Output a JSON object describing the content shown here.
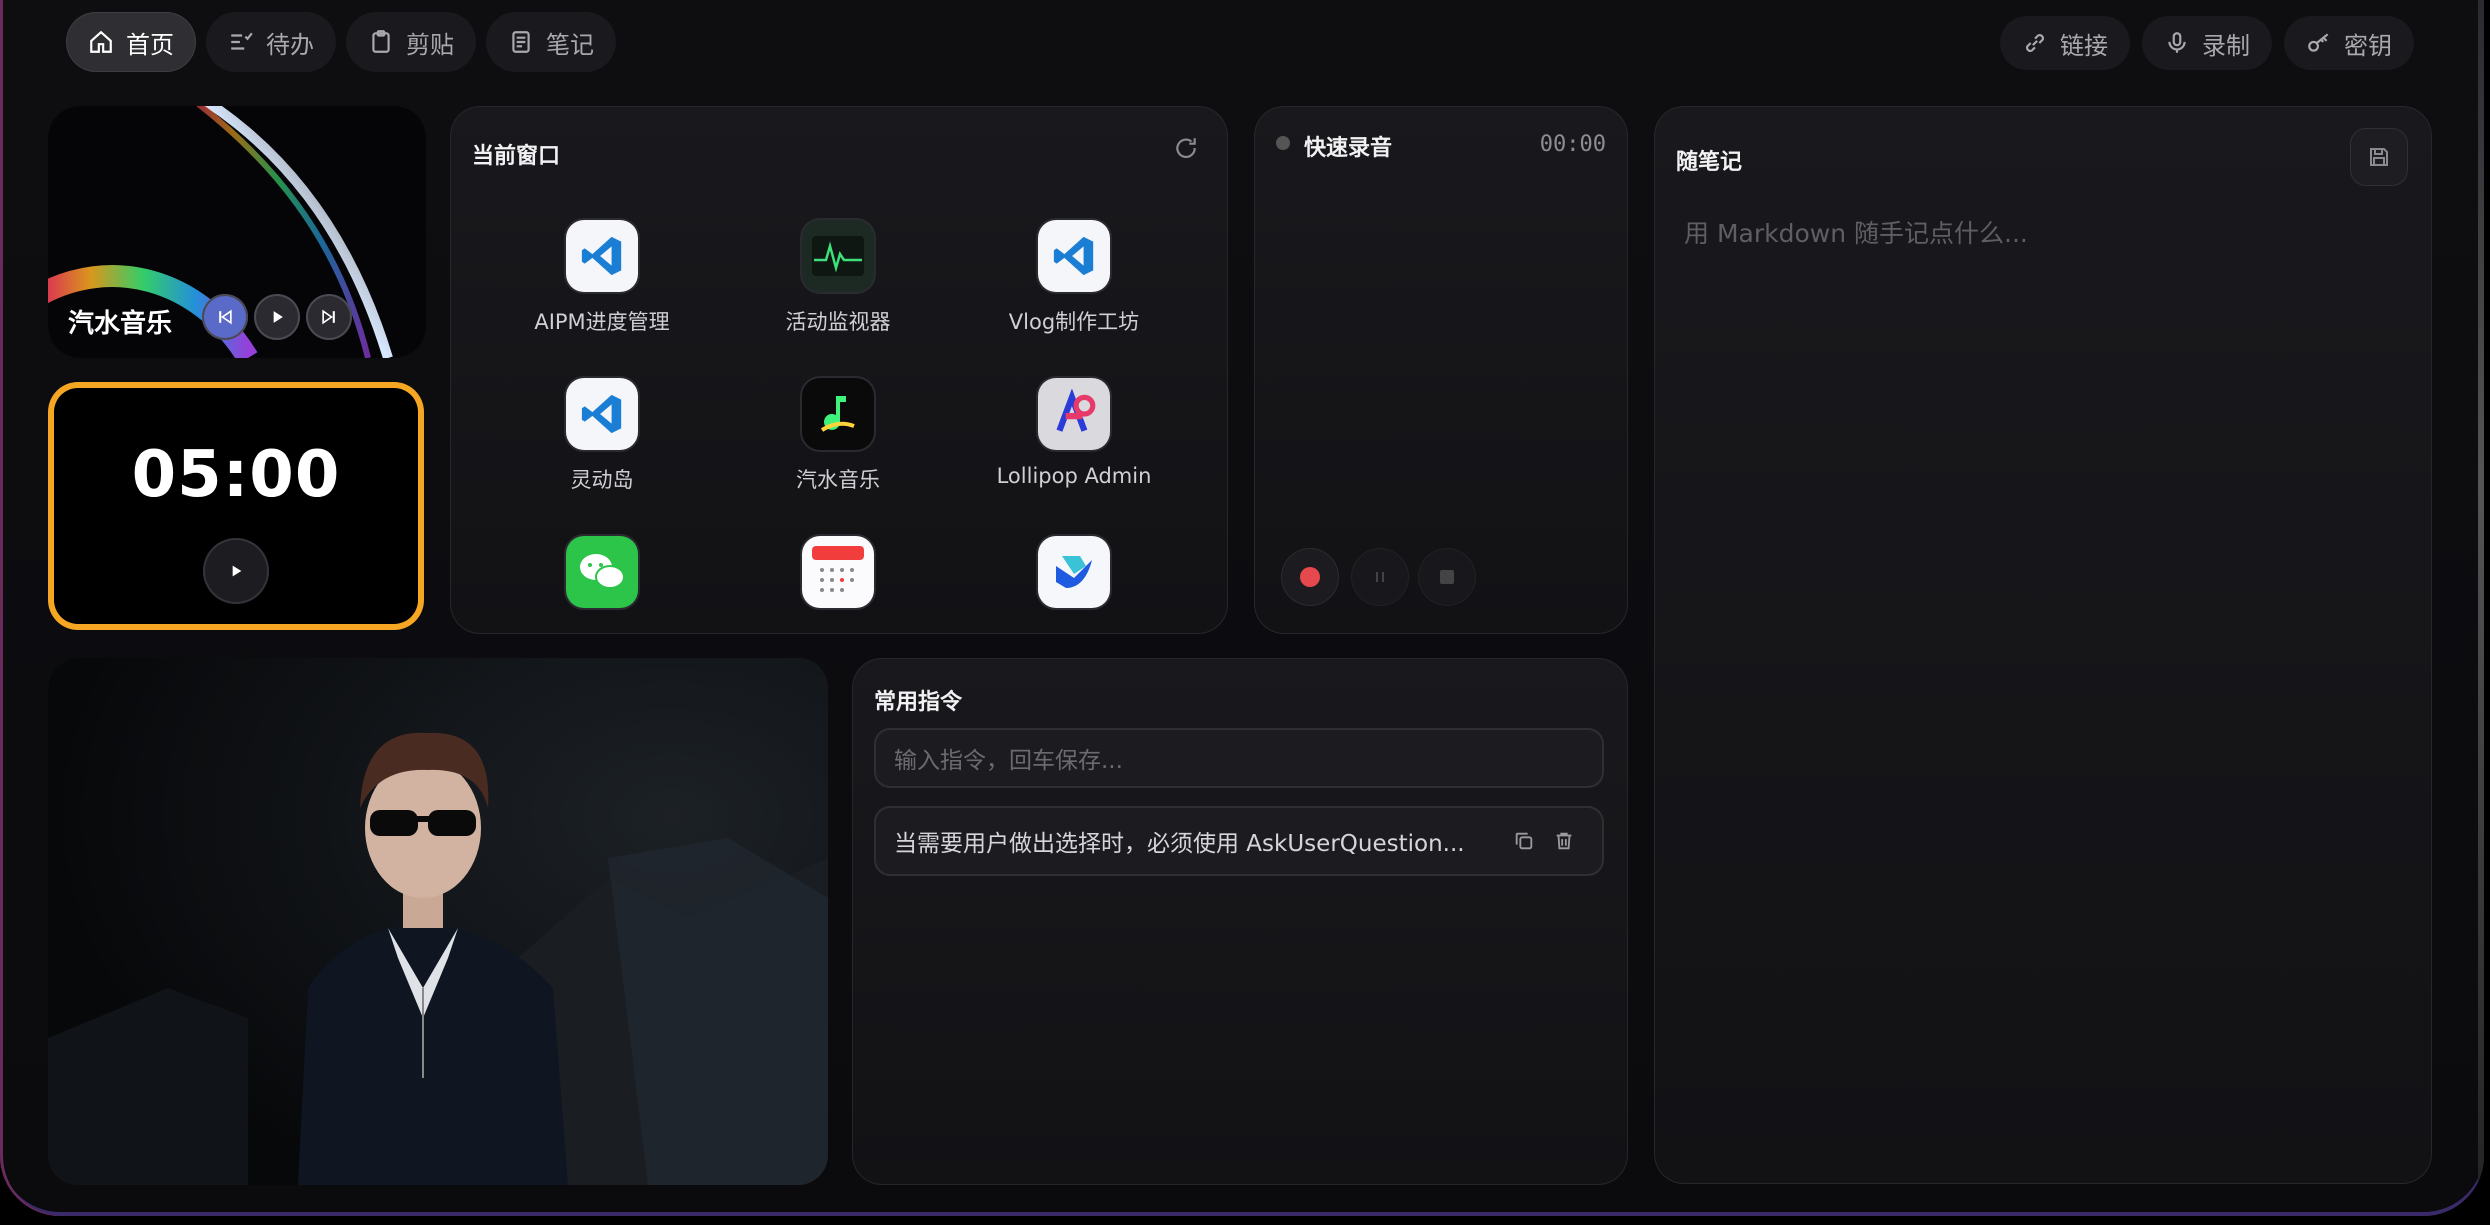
{
  "nav": {
    "tabs": [
      {
        "label": "首页",
        "icon": "home-icon",
        "active": true
      },
      {
        "label": "待办",
        "icon": "todo-list-icon"
      },
      {
        "label": "剪贴",
        "icon": "clipboard-icon"
      },
      {
        "label": "笔记",
        "icon": "note-icon"
      }
    ],
    "right": [
      {
        "label": "链接",
        "icon": "link-icon"
      },
      {
        "label": "录制",
        "icon": "microphone-icon"
      },
      {
        "label": "密钥",
        "icon": "key-icon"
      }
    ]
  },
  "music": {
    "title": "汽水音乐"
  },
  "timer": {
    "value": "05:00"
  },
  "windows": {
    "title": "当前窗口",
    "apps": [
      {
        "label": "AIPM进度管理",
        "icon": "vscode-icon"
      },
      {
        "label": "活动监视器",
        "icon": "activity-monitor-icon"
      },
      {
        "label": "Vlog制作工坊",
        "icon": "vscode-icon"
      },
      {
        "label": "灵动岛",
        "icon": "vscode-icon"
      },
      {
        "label": "汽水音乐",
        "icon": "music-app-icon"
      },
      {
        "label": "Lollipop Admin",
        "icon": "lollipop-app-icon"
      },
      {
        "label": "",
        "icon": "wechat-icon"
      },
      {
        "label": "",
        "icon": "calendar-icon"
      },
      {
        "label": "",
        "icon": "feishu-icon"
      }
    ]
  },
  "recorder": {
    "title": "快速录音",
    "time": "00:00"
  },
  "notes": {
    "title": "随笔记",
    "placeholder": "用 Markdown 随手记点什么..."
  },
  "commands": {
    "title": "常用指令",
    "input_placeholder": "输入指令，回车保存...",
    "items": [
      {
        "text": "当需要用户做出选择时，必须使用 AskUserQuestion..."
      }
    ]
  },
  "colors": {
    "timer_border": "#f5a623",
    "record_red": "#e5484d"
  }
}
